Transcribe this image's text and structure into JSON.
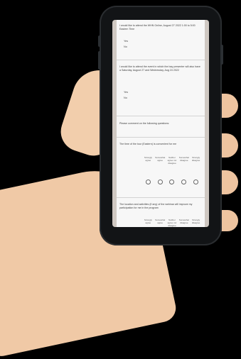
{
  "survey": {
    "q1": "I would like to attend the WHN Online, August 27 2022 1:00 to 5:00 Eastern Time",
    "q1_options": [
      "Yes",
      "No"
    ],
    "q2": "I would like to attend the event in which the bay presenter will also have a Saturday, August 27 and Wednesday, Aug 24 2022",
    "q2_options": [
      "Yes",
      "No"
    ],
    "q3": "Please comment on the following questions:",
    "q4": "The time of the tour (Eastern) is convenient for me",
    "scale_labels": [
      "Strongly agree",
      "Somewhat agree",
      "Neither agree nor disagree",
      "Somewhat disagree",
      "Strongly disagree"
    ],
    "q5": "The location and activities (if any) of the webinar will improve my participation for me in the program",
    "scale_labels_2": [
      "Strongly agree",
      "Somewhat agree",
      "Neither agree nor disagree",
      "Somewhat disagree",
      "Strongly disagree"
    ]
  }
}
